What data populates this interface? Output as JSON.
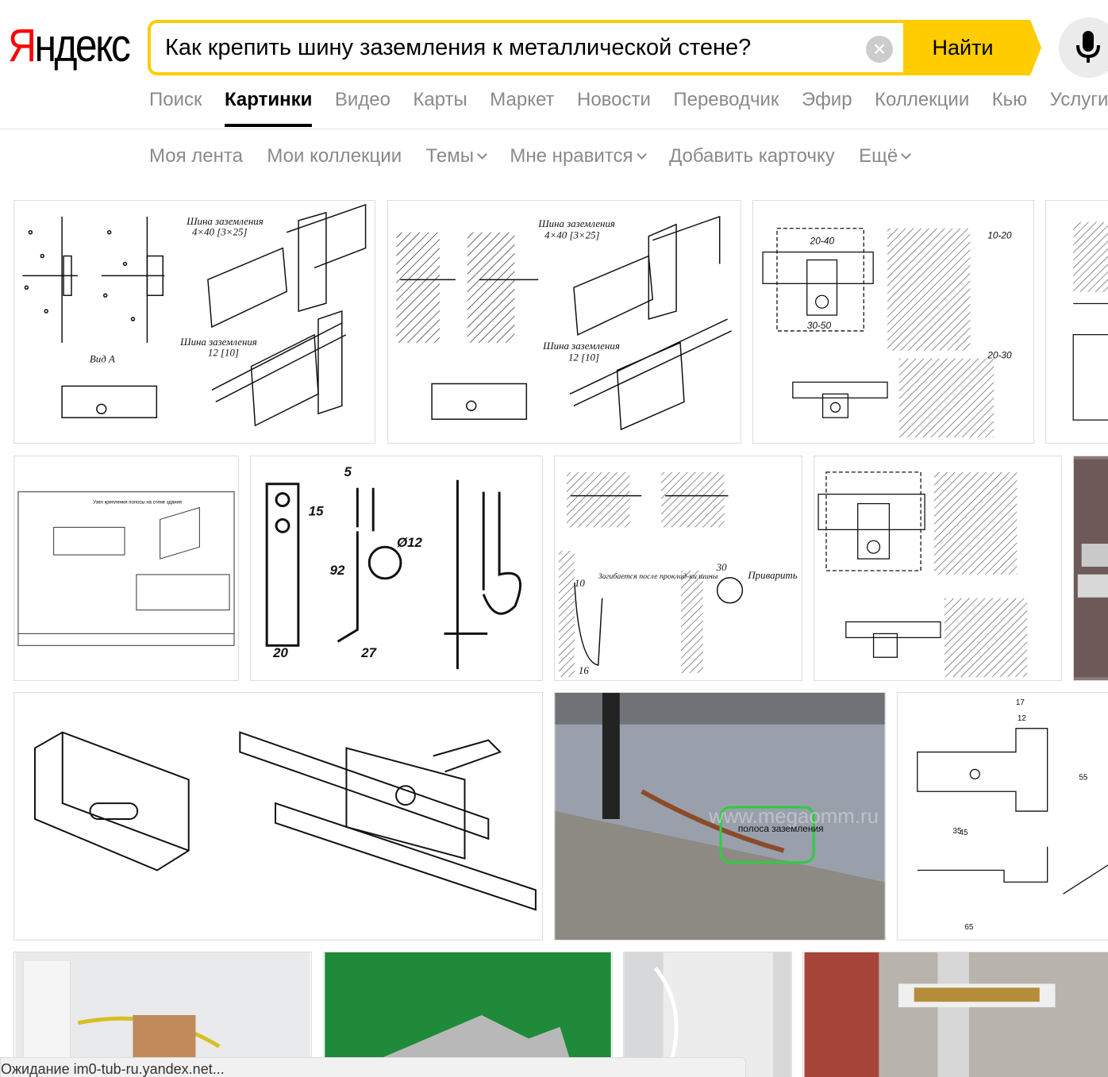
{
  "header": {
    "logo_first": "Я",
    "logo_rest": "ндекс",
    "search_value": "Как крепить шину заземления к металлической стене?",
    "search_button": "Найти"
  },
  "services": [
    "Поиск",
    "Картинки",
    "Видео",
    "Карты",
    "Маркет",
    "Новости",
    "Переводчик",
    "Эфир",
    "Коллекции",
    "Кью",
    "Услуги"
  ],
  "subnav": {
    "my_feed": "Моя лента",
    "my_collections": "Мои коллекции",
    "themes": "Темы",
    "likes": "Мне нравится",
    "add_card": "Добавить карточку",
    "more": "Ещё"
  },
  "tiles": {
    "t1": {
      "bus_label": "Шина заземления",
      "bus_size": "4×40 [3×25]",
      "bus_label2": "Шина заземления",
      "bus_size2": "12 [10]",
      "view_label": "Вид А"
    },
    "t2": {
      "bus_label": "Шина заземления",
      "bus_size": "4×40 [3×25]",
      "bus_label2": "Шина заземления",
      "bus_size2": "12 [10]"
    },
    "t3": {
      "dim1": "20-40",
      "dim2": "30-50",
      "dim3": "10-20",
      "dim4": "20-30"
    },
    "t5": {
      "title": "Узел крепления полосы на стене здания"
    },
    "t6": {
      "dim_5": "5",
      "dim_15": "15",
      "dim_92": "92",
      "dim_20": "20",
      "dim_27": "27",
      "dim_d12": "Ø12"
    },
    "t7": {
      "bend_label": "Загибается после проклад-ки шины",
      "weld_label": "Приварить",
      "dim_30": "30",
      "dim_10": "10",
      "dim_16": "16"
    },
    "t9": {
      "label": "полоса заземления",
      "watermark": "www.megaomm.ru"
    },
    "t10": {
      "dim_17": "17",
      "dim_12": "12",
      "dim_45": "45",
      "dim_65": "65",
      "dim_35": "35",
      "dim_55": "55"
    }
  },
  "status_text": "Ожидание im0-tub-ru.yandex.net..."
}
